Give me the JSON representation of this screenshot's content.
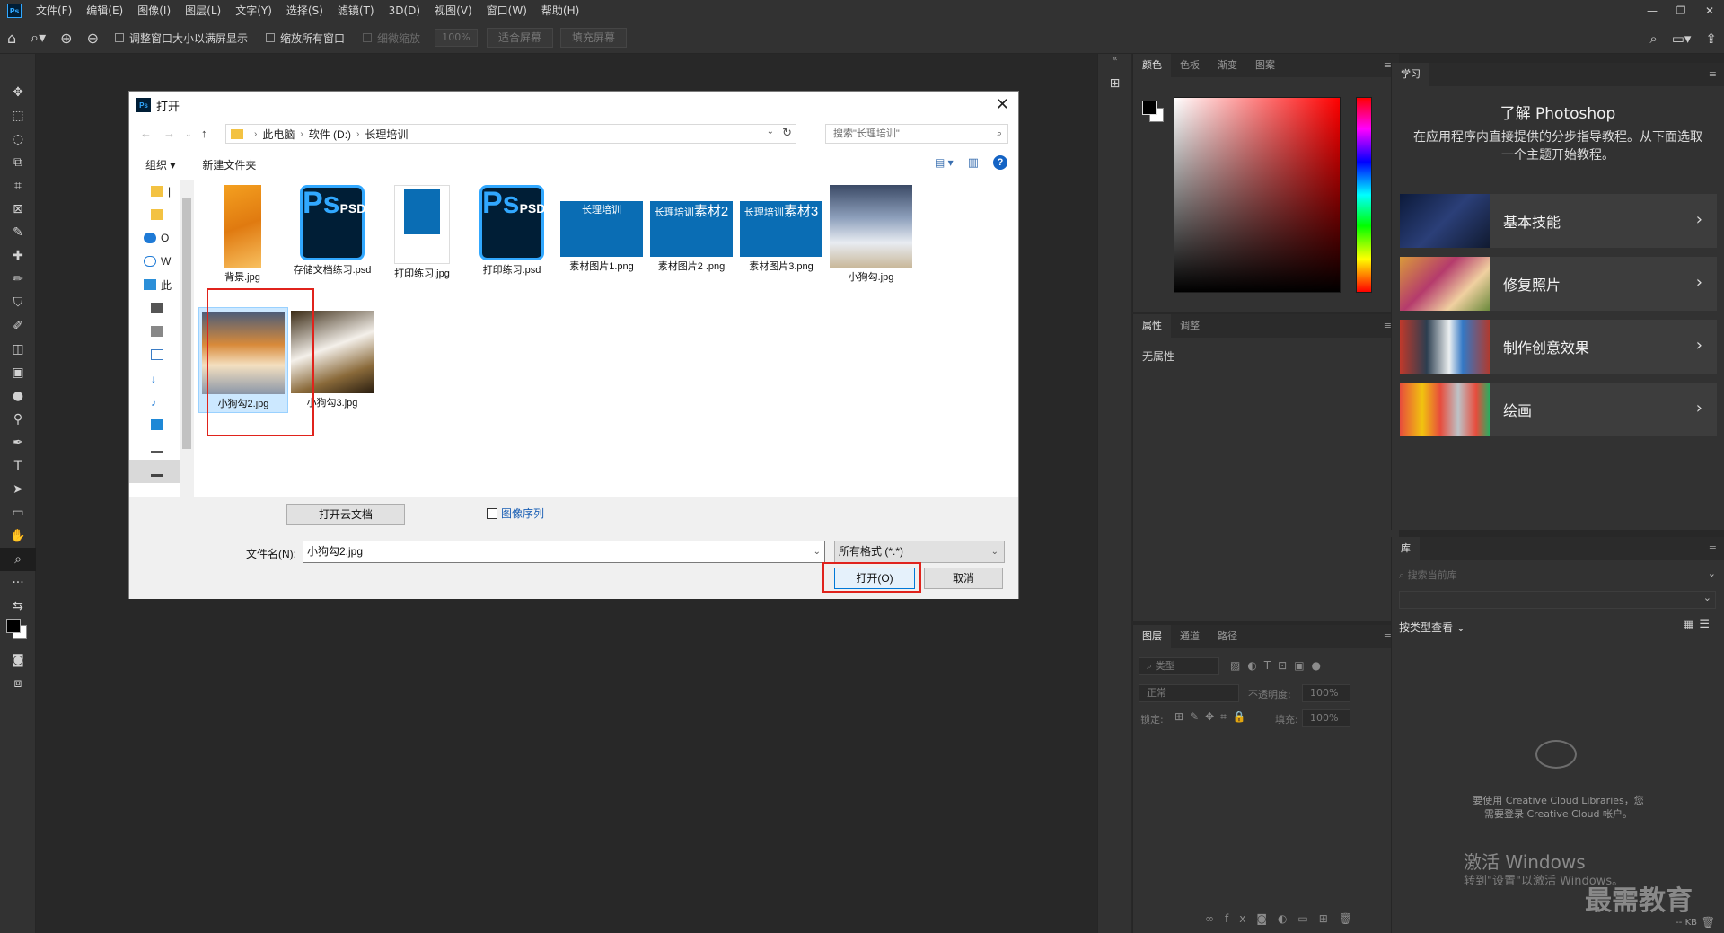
{
  "menubar": {
    "logo": "Ps",
    "items": [
      "文件(F)",
      "编辑(E)",
      "图像(I)",
      "图层(L)",
      "文字(Y)",
      "选择(S)",
      "滤镜(T)",
      "3D(D)",
      "视图(V)",
      "窗口(W)",
      "帮助(H)"
    ]
  },
  "optionsbar": {
    "check_fit_window": "调整窗口大小以满屏显示",
    "check_zoom_all": "缩放所有窗口",
    "check_scrubby": "细微缩放",
    "zoom_value": "100%",
    "btn_fit_screen": "适合屏幕",
    "btn_fill_screen": "填充屏幕"
  },
  "dialog": {
    "title": "打开",
    "logo": "Ps",
    "breadcrumb": [
      "此电脑",
      "软件 (D:)",
      "长理培训"
    ],
    "search_placeholder": "搜索\"长理培训\"",
    "cmd_organize": "组织 ▾",
    "cmd_new_folder": "新建文件夹",
    "help": "?",
    "nav_items": [
      "|",
      "",
      "O",
      "W",
      "此",
      "",
      "",
      "",
      "",
      "",
      "",
      "",
      "",
      ""
    ],
    "files": [
      {
        "name": "背景.jpg",
        "kind": "orange-photo"
      },
      {
        "name": "存储文档练习.psd",
        "kind": "psd"
      },
      {
        "name": "打印练习.jpg",
        "kind": "doc-photo"
      },
      {
        "name": "打印练习.psd",
        "kind": "psd"
      },
      {
        "name": "素材图片1.png",
        "kind": "blue",
        "label": "长理培训",
        "sub": ""
      },
      {
        "name": "素材图片2 .png",
        "kind": "blue",
        "label": "长理培训",
        "sub": "素材2"
      },
      {
        "name": "素材图片3.png",
        "kind": "blue",
        "label": "长理培训",
        "sub": "素材3"
      },
      {
        "name": "小狗勾.jpg",
        "kind": "dog-snow"
      },
      {
        "name": "小狗勾2.jpg",
        "kind": "dog-shiba"
      },
      {
        "name": "小狗勾3.jpg",
        "kind": "dog-white"
      }
    ],
    "psd_ps": "Ps",
    "psd_label": "PSD",
    "btn_cloud": "打开云文档",
    "check_sequence": "图像序列",
    "filename_label": "文件名(N):",
    "filename_value": "小狗勾2.jpg",
    "filetype_value": "所有格式 (*.*)",
    "btn_open": "打开(O)",
    "btn_cancel": "取消"
  },
  "panels": {
    "color_tabs": [
      "颜色",
      "色板",
      "渐变",
      "图案"
    ],
    "props_tabs": [
      "属性",
      "调整"
    ],
    "props_empty": "无属性",
    "layers_tabs": [
      "图层",
      "通道",
      "路径"
    ],
    "layers_filter": "类型",
    "blend_mode": "正常",
    "opacity_label": "不透明度:",
    "opacity_value": "100%",
    "lock_label": "锁定:",
    "fill_label": "填充:",
    "fill_value": "100%",
    "learn_tab": "学习",
    "learn_title": "了解 Photoshop",
    "learn_desc": "在应用程序内直接提供的分步指导教程。从下面选取一个主题开始教程。",
    "learn_items": [
      "基本技能",
      "修复照片",
      "制作创意效果",
      "绘画"
    ],
    "lib_tab": "库",
    "lib_search": "搜索当前库",
    "lib_view": "按类型查看",
    "lib_msg_1": "要使用 Creative Cloud Libraries，您",
    "lib_msg_2": "需要登录 Creative Cloud 帐户。",
    "lib_kb": "-- KB"
  },
  "watermark": {
    "line1": "激活 Windows",
    "line2": "转到\"设置\"以激活 Windows。",
    "brand": "最需教育"
  },
  "colors": {
    "accent": "#31a8ff",
    "highlight_box": "#e0231c"
  }
}
